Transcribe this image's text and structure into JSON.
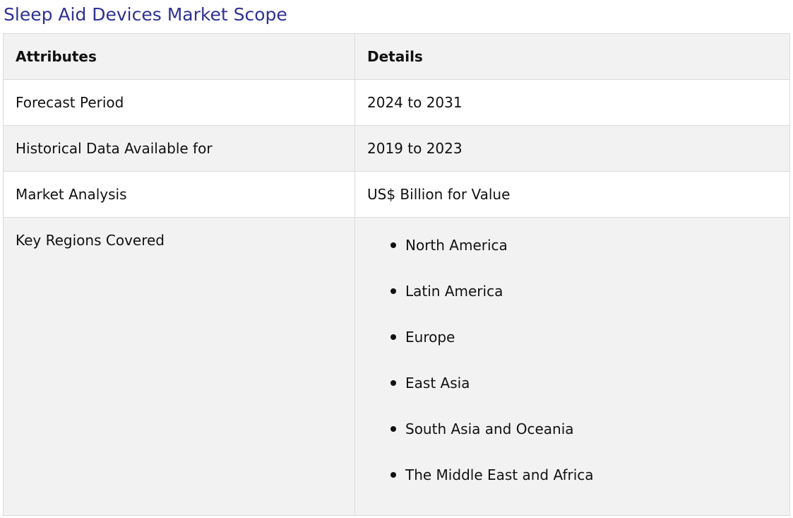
{
  "title": "Sleep Aid Devices Market Scope",
  "table": {
    "headers": [
      "Attributes",
      "Details"
    ],
    "rows": [
      {
        "attribute": "Forecast Period",
        "detail": "2024 to 2031"
      },
      {
        "attribute": "Historical Data Available for",
        "detail": "2019 to 2023"
      },
      {
        "attribute": "Market Analysis",
        "detail": "US$ Billion for Value"
      },
      {
        "attribute": "Key Regions Covered",
        "regions": [
          "North America",
          "Latin America",
          "Europe",
          "East Asia",
          "South Asia and Oceania",
          "The Middle East and Africa"
        ]
      }
    ]
  },
  "colors": {
    "title": "#2e3192",
    "shaded_row": "#f2f2f2",
    "border": "#dcdcdc"
  }
}
